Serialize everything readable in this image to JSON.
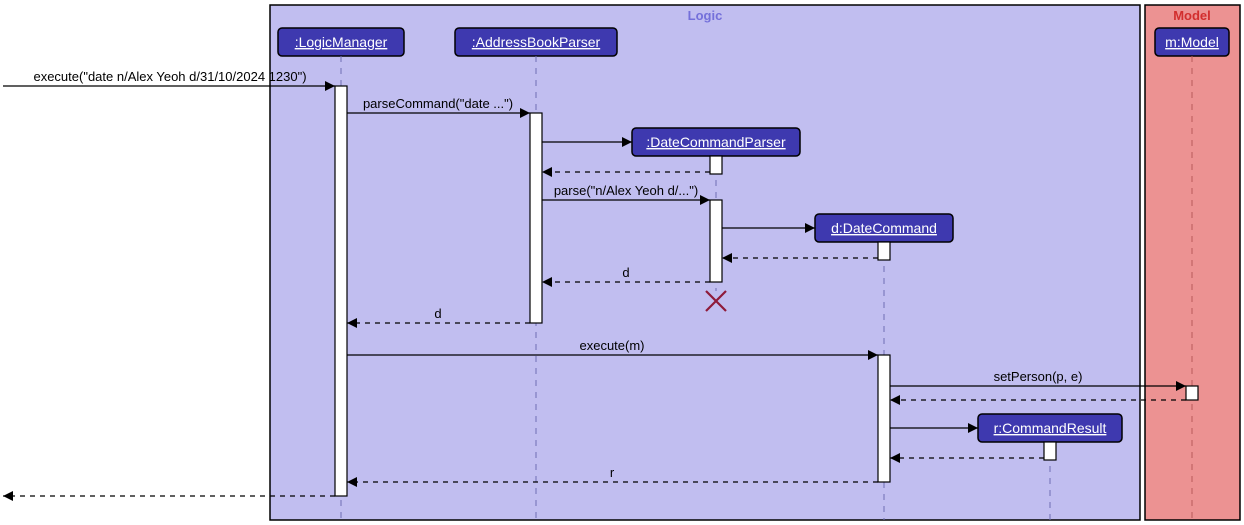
{
  "frames": {
    "logic": {
      "label": "Logic"
    },
    "model": {
      "label": "Model"
    }
  },
  "participants": {
    "logicManager": ":LogicManager",
    "addressBookParser": ":AddressBookParser",
    "dateCommandParser": ":DateCommandParser",
    "dateCommand": "d:DateCommand",
    "commandResult": "r:CommandResult",
    "model": "m:Model"
  },
  "messages": {
    "m1": "execute(\"date n/Alex Yeoh d/31/10/2024 1230\")",
    "m2": "parseCommand(\"date ...\")",
    "m3": "",
    "m4": "",
    "m5": "parse(\"n/Alex Yeoh d/...\")",
    "m6": "",
    "m7": "",
    "m8": "d",
    "m9": "d",
    "m10": "execute(m)",
    "m11": "setPerson(p, e)",
    "m12": "",
    "m13": "",
    "m14": "",
    "m15": "r",
    "m16": ""
  }
}
